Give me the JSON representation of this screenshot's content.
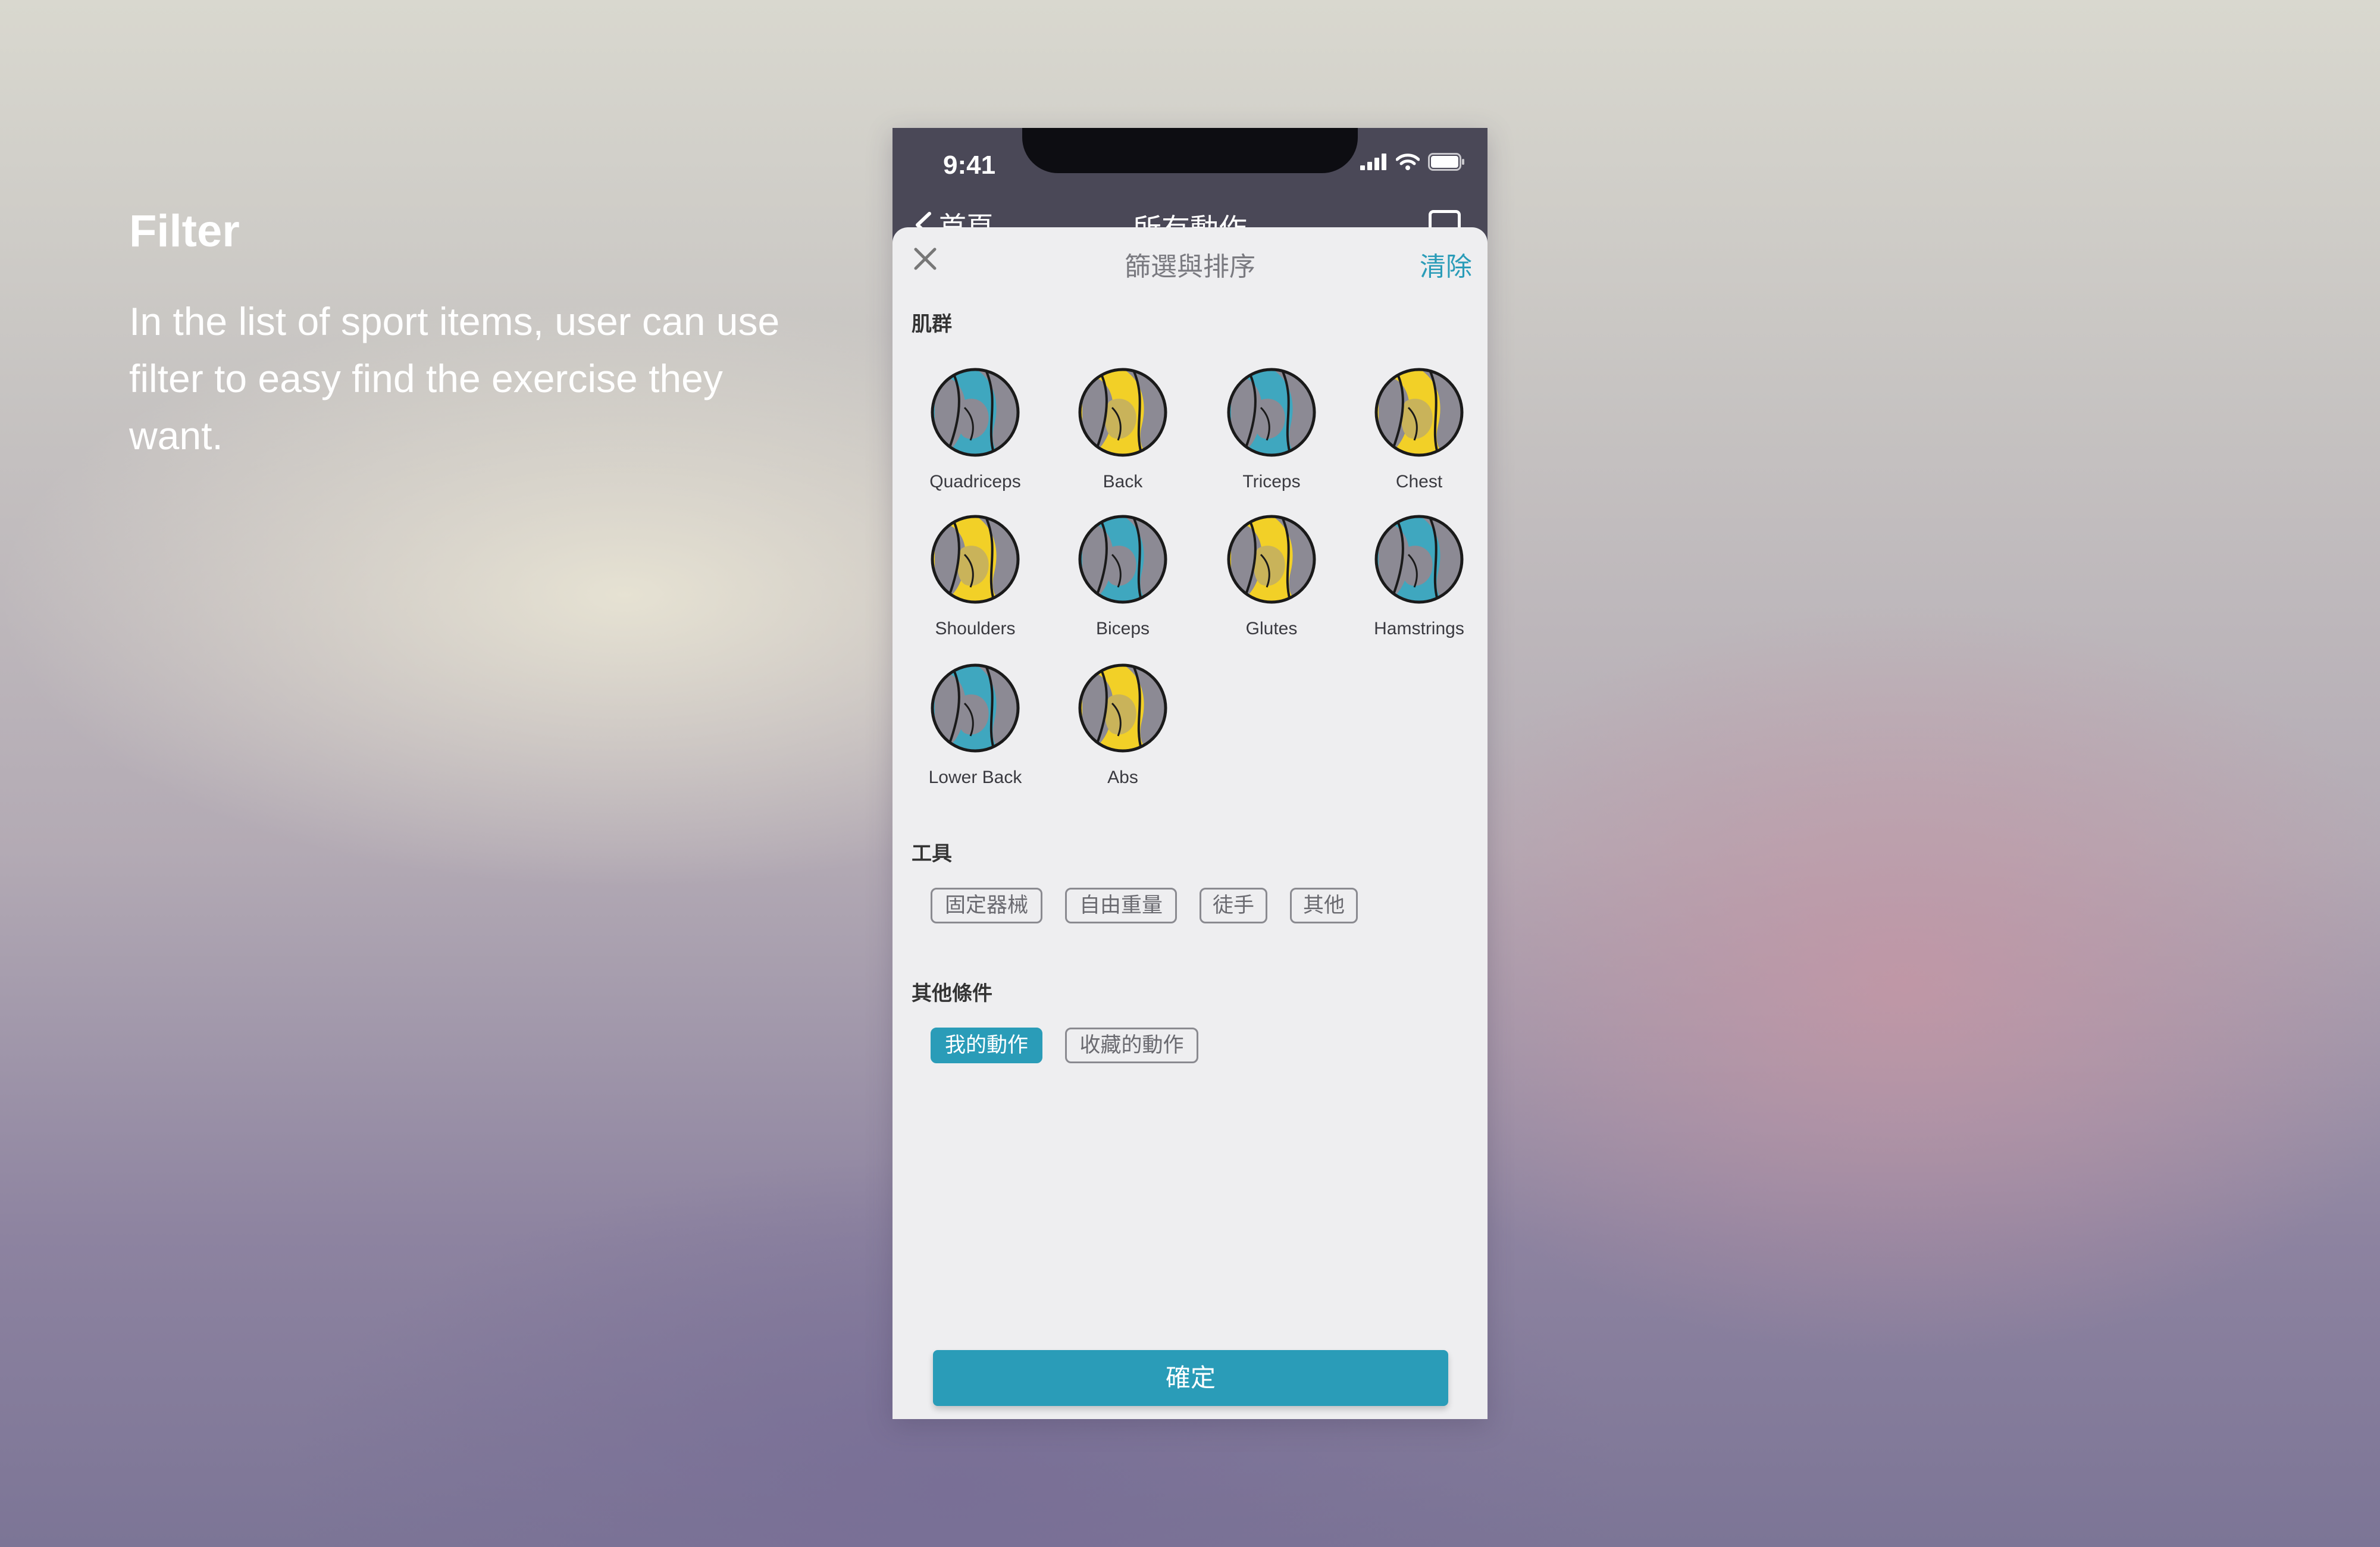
{
  "side": {
    "title": "Filter",
    "description": "In the list of sport items, user can use filter to easy find the exercise they want."
  },
  "status_bar": {
    "time": "9:41"
  },
  "nav": {
    "back_label": "首頁",
    "title": "所有動作"
  },
  "sheet": {
    "title": "篩選與排序",
    "clear_label": "清除",
    "muscle_section": "肌群",
    "muscles": [
      {
        "label": "Quadriceps",
        "icon": "quadriceps-icon",
        "accent": "#3fa7bf"
      },
      {
        "label": "Back",
        "icon": "back-icon",
        "accent": "#f2d027"
      },
      {
        "label": "Triceps",
        "icon": "triceps-icon",
        "accent": "#3fa7bf"
      },
      {
        "label": "Chest",
        "icon": "chest-icon",
        "accent": "#f2d027"
      },
      {
        "label": "Shoulders",
        "icon": "shoulders-icon",
        "accent": "#f2d027"
      },
      {
        "label": "Biceps",
        "icon": "biceps-icon",
        "accent": "#3fa7bf"
      },
      {
        "label": "Glutes",
        "icon": "glutes-icon",
        "accent": "#f2d027"
      },
      {
        "label": "Hamstrings",
        "icon": "hamstrings-icon",
        "accent": "#3fa7bf"
      },
      {
        "label": "Lower Back",
        "icon": "lower-back-icon",
        "accent": "#3fa7bf"
      },
      {
        "label": "Abs",
        "icon": "abs-icon",
        "accent": "#f2d027"
      }
    ],
    "equipment_section": "工具",
    "equipment": [
      "固定器械",
      "自由重量",
      "徒手",
      "其他"
    ],
    "other_section": "其他條件",
    "other": [
      {
        "label": "我的動作",
        "selected": true
      },
      {
        "label": "收藏的動作",
        "selected": false
      }
    ],
    "confirm_label": "確定"
  },
  "colors": {
    "accent": "#2a9cb8",
    "yellow": "#f2d027",
    "blue": "#3fa7bf"
  }
}
